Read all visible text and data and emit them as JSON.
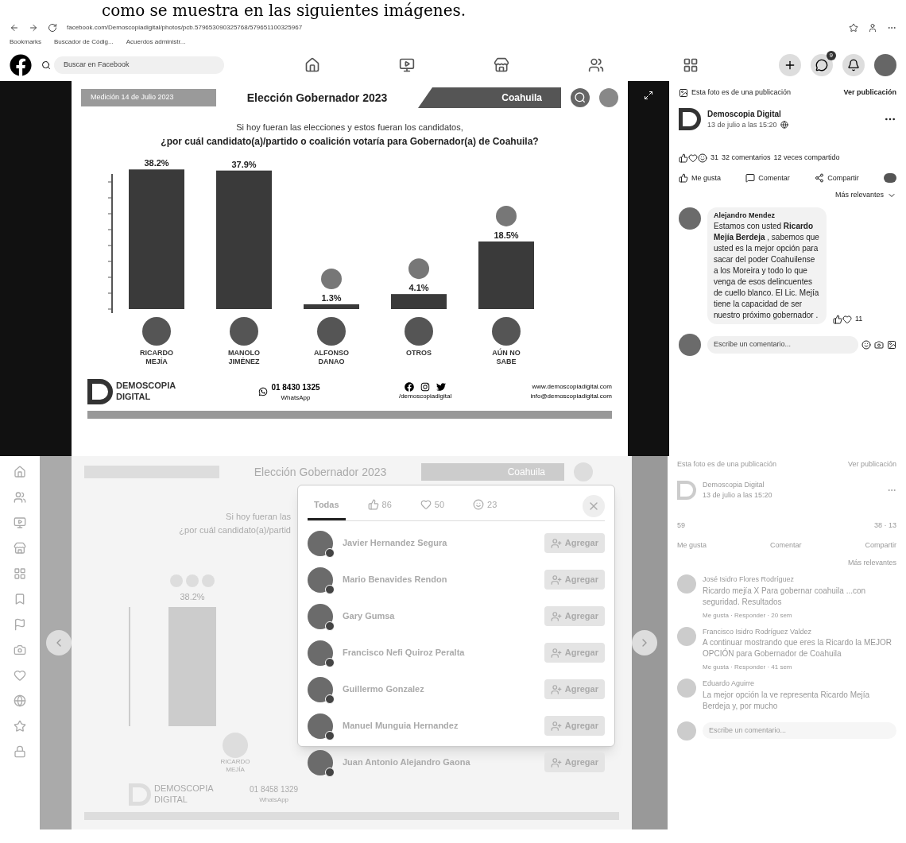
{
  "caption": "como se muestra en las siguientes imágenes.",
  "browser": {
    "url": "facebook.com/Demoscopiadigital/photos/pcb.579653090325768/579651100325967",
    "bookmarks": [
      "Bookmarks",
      "Buscador de Códig...",
      "Acuerdos administr..."
    ]
  },
  "facebook_nav": {
    "search_placeholder": "Buscar en Facebook",
    "notification_badge": "9"
  },
  "post_image": {
    "date_label": "Medición 14 de Julio 2023",
    "title": "Elección Gobernador 2023",
    "region": "Coahuila",
    "question_intro": "Si hoy fueran las elecciones y estos fueran los candidatos,",
    "question": "¿por cuál candidato(a)/partido o coalición votaría para Gobernador(a) de Coahuila?",
    "chart_data": {
      "type": "bar",
      "categories": [
        "RICARDO MEJÍA",
        "MANOLO JIMÉNEZ",
        "ALFONSO DANAO",
        "OTROS",
        "AÚN NO SABE"
      ],
      "series": [
        {
          "color": "#3a3a3a",
          "values": [
            38.2,
            37.9,
            1.3,
            4.1,
            18.5
          ]
        }
      ],
      "data_labels": true
    },
    "value_suffix": "%",
    "brand": "DEMOSCOPIA DIGITAL",
    "phone": "01 8430 1325",
    "phone_label": "WhatsApp",
    "social_handle": "/demoscopiadigital",
    "website": "www.demoscopiadigital.com",
    "email": "info@demoscopiadigital.com"
  },
  "post_panel": {
    "notice": "Esta foto es de una publicación",
    "notice_link": "Ver publicación",
    "page_name": "Demoscopia Digital",
    "posted": "13 de julio a las 15:20",
    "reaction_count": "31",
    "comments": "32 comentarios",
    "shares": "12 veces compartido",
    "actions": [
      "Me gusta",
      "Comentar",
      "Compartir"
    ],
    "sort": "Más relevantes",
    "comment": {
      "author": "Alejandro Mendez",
      "text": "Estamos con usted **Ricardo Mejía Berdeja** , sabemos que usted es la mejor opción para sacar del poder Coahuilense a los Moreira y todo lo que venga de esos delincuentes de cuello blanco. El Lic. Mejía tiene la capacidad de ser nuestro próximo gobernador .",
      "reactions": "11"
    },
    "input_placeholder": "Escribe un comentario..."
  },
  "second_view": {
    "background": {
      "title": "Elección Gobernador 2023",
      "region": "Coahuila",
      "question_intro": "Si hoy fueran las",
      "question": "¿por cuál candidato(a)/partid",
      "value_label": "38.2%",
      "candidate": "RICARDO MEJÍA",
      "brand": "DEMOSCOPIA DIGITAL",
      "phone": "01 8458 1329",
      "phone_label": "WhatsApp"
    },
    "reactions_dialog": {
      "tabs": [
        {
          "kind": "all",
          "label": "Todas",
          "selected": true
        },
        {
          "kind": "like",
          "label": "86",
          "selected": false
        },
        {
          "kind": "love",
          "label": "50",
          "selected": false
        },
        {
          "kind": "care",
          "label": "23",
          "selected": false
        }
      ],
      "people": [
        {
          "name": "Javier Hernandez Segura",
          "action": "Agregar"
        },
        {
          "name": "Mario Benavides Rendon",
          "action": "Agregar"
        },
        {
          "name": "Gary Gumsa",
          "action": "Agregar"
        },
        {
          "name": "Francisco Nefi Quiroz Peralta",
          "action": "Agregar"
        },
        {
          "name": "Guillermo Gonzalez",
          "action": "Agregar"
        },
        {
          "name": "Manuel Munguia Hernandez",
          "action": "Agregar"
        },
        {
          "name": "Juan Antonio Alejandro Gaona",
          "action": "Agregar"
        }
      ]
    },
    "side_panel": {
      "notice": "Esta foto es de una publicación",
      "notice_link": "Ver publicación",
      "page_name": "Demoscopia Digital",
      "posted": "13 de julio a las 15:20",
      "reaction_count": "59",
      "counts": "38 · 13",
      "actions": [
        "Me gusta",
        "Comentar",
        "Compartir"
      ],
      "sort": "Más relevantes",
      "comments": [
        {
          "author": "José Isidro Flores Rodríguez",
          "text": "Ricardo mejía X Para gobernar coahuila ...con seguridad. Resultados",
          "meta": "Me gusta · Responder · 20 sem"
        },
        {
          "author": "Francisco Isidro Rodríguez Valdez",
          "text": "A continuar mostrando que eres la Ricardo la MEJOR OPCIÓN para Gobernador de Coahuila",
          "meta": "Me gusta · Responder · 41 sem"
        },
        {
          "author": "Eduardo Aguirre",
          "text": "La mejor opción la ve representa Ricardo Mejía Berdeja y, por mucho"
        }
      ],
      "input_placeholder": "Escribe un comentario..."
    }
  }
}
